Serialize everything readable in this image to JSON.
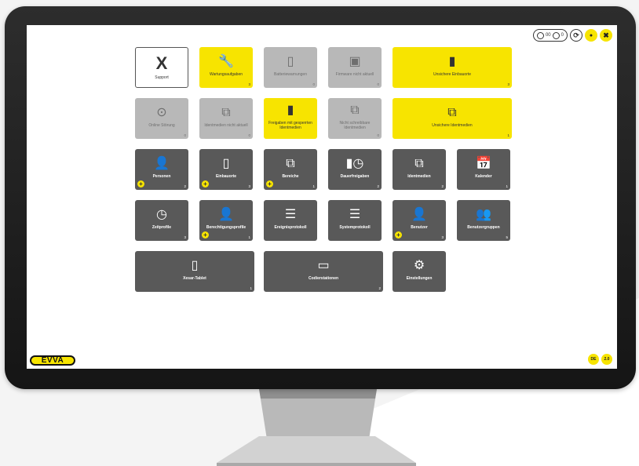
{
  "topbar": {
    "storage_count": "00",
    "battery_count": "0"
  },
  "row1": [
    {
      "label": "Support",
      "glyph": "X",
      "style": "outline",
      "count": ""
    },
    {
      "label": "Wartungsaufgaben",
      "glyph": "🔧",
      "style": "yellow",
      "count": "3"
    },
    {
      "label": "Batteriewarnungen",
      "glyph": "▯",
      "style": "grey",
      "count": "0"
    },
    {
      "label": "Firmware nicht aktuell",
      "glyph": "▣",
      "style": "grey",
      "count": "0"
    },
    {
      "label": "Unsichere Einbauorte",
      "glyph": "▮",
      "style": "yellow",
      "count": "3"
    }
  ],
  "row2": [
    {
      "label": "Online Störung",
      "glyph": "⊙",
      "style": "grey",
      "count": "0"
    },
    {
      "label": "Identmedien nicht aktuell",
      "glyph": "⧉",
      "style": "grey",
      "count": "0"
    },
    {
      "label": "Freigaben mit gesperrten Identmedien",
      "glyph": "▮",
      "style": "yellow",
      "count": ""
    },
    {
      "label": "Nicht schreibbare Identmedien",
      "glyph": "⧉",
      "style": "grey",
      "count": "0"
    },
    {
      "label": "Unsichere Identmedien",
      "glyph": "⧉",
      "style": "yellow",
      "count": "1"
    }
  ],
  "row3": [
    {
      "label": "Personen",
      "glyph": "👤",
      "count": "2"
    },
    {
      "label": "Einbauorte",
      "glyph": "▯",
      "count": "3"
    },
    {
      "label": "Bereiche",
      "glyph": "⧉",
      "count": "1"
    },
    {
      "label": "Dauerfreigaben",
      "glyph": "▮◷",
      "count": "2"
    },
    {
      "label": "Identmedien",
      "glyph": "⧉",
      "count": "2"
    },
    {
      "label": "Kalender",
      "glyph": "📅",
      "count": "1"
    }
  ],
  "row4": [
    {
      "label": "Zeitprofile",
      "glyph": "◷",
      "count": "3"
    },
    {
      "label": "Berechtigungsprofile",
      "glyph": "👤",
      "count": "1"
    },
    {
      "label": "Ereignisprotokoll",
      "glyph": "☰",
      "count": ""
    },
    {
      "label": "Systemprotokoll",
      "glyph": "☰",
      "count": ""
    },
    {
      "label": "Benutzer",
      "glyph": "👤",
      "count": "3"
    },
    {
      "label": "Benutzergruppen",
      "glyph": "👥",
      "count": "5"
    }
  ],
  "row5": [
    {
      "label": "Xesar-Tablet",
      "glyph": "▯",
      "count": "1"
    },
    {
      "label": "Codierstationen",
      "glyph": "▭",
      "count": "2"
    },
    {
      "label": "Einstellungen",
      "glyph": "⚙",
      "count": ""
    }
  ],
  "footer": {
    "logo_text": "EVVA",
    "lang_label": "DE",
    "user_label": "2.0"
  },
  "colors": {
    "yellow": "#f7e400",
    "dark": "#595959",
    "grey": "#b8b8b8"
  }
}
